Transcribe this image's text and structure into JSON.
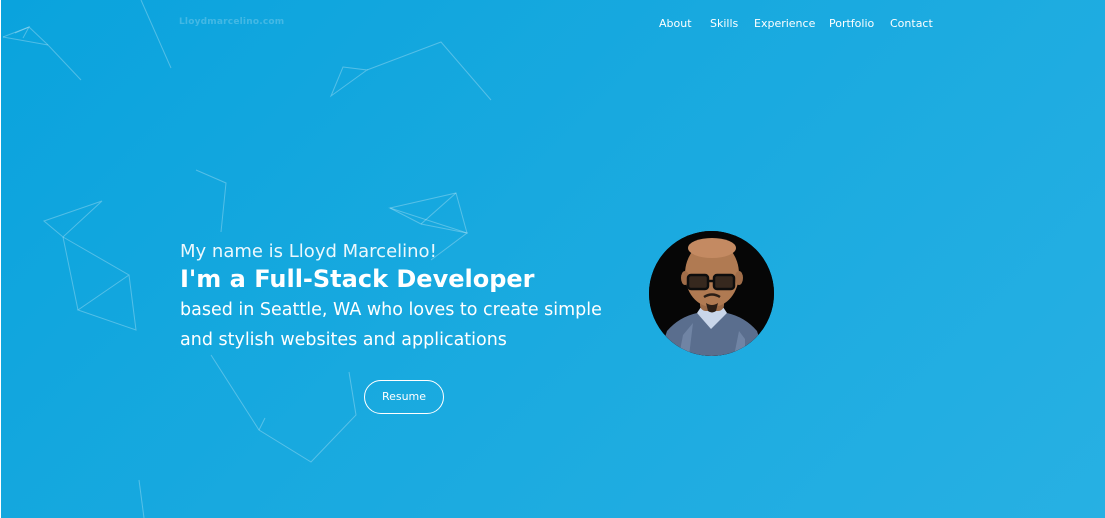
{
  "header": {
    "brand": "Lloydmarcelino.com",
    "nav": [
      "About",
      "Skills",
      "Experience",
      "Portfolio",
      "Contact"
    ]
  },
  "hero": {
    "greeting": "My name is Lloyd Marcelino!",
    "headline": "I'm a Full-Stack Developer",
    "description_line1": "based in Seattle, WA who loves to create simple",
    "description_line2": "and stylish websites and applications",
    "resume_label": "Resume"
  },
  "colors": {
    "background_start": "#0aa3dd",
    "background_end": "#27b0e3",
    "text": "#ffffff"
  },
  "icons": [
    "profile-photo"
  ]
}
